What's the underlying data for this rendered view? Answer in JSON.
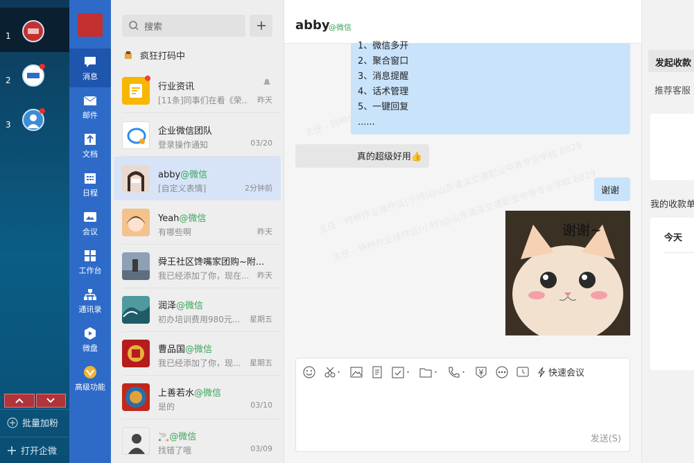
{
  "accounts": [
    {
      "num": "1"
    },
    {
      "num": "2",
      "badge": true
    },
    {
      "num": "3",
      "badge": true
    }
  ],
  "account_bar": {
    "batch_add": "批量加粉",
    "open_wecom": "打开企微"
  },
  "nav": [
    {
      "label": "消息",
      "icon": "chat-bubble-icon"
    },
    {
      "label": "邮件",
      "icon": "mail-icon"
    },
    {
      "label": "文档",
      "icon": "document-icon"
    },
    {
      "label": "日程",
      "icon": "calendar-icon"
    },
    {
      "label": "会议",
      "icon": "meeting-icon"
    },
    {
      "label": "工作台",
      "icon": "workbench-icon"
    },
    {
      "label": "通讯录",
      "icon": "contacts-icon"
    },
    {
      "label": "微盘",
      "icon": "cloud-drive-icon"
    },
    {
      "label": "高级功能",
      "icon": "advanced-icon"
    }
  ],
  "search": {
    "placeholder": "搜索"
  },
  "status": {
    "text": "疯狂打码中"
  },
  "conversations": [
    {
      "name": "行业资讯",
      "wx": "",
      "preview": "[11条]同事们在看《荣...",
      "time": "昨天",
      "badge": true,
      "muted": true,
      "color": "#f7b600"
    },
    {
      "name": "企业微信团队",
      "wx": "",
      "preview": "登录操作通知",
      "time": "03/20",
      "color": "#ffffff"
    },
    {
      "name": "abby",
      "wx": "@微信",
      "preview": "[自定义表情]",
      "time": "2分钟前",
      "color": "#e9d9d1"
    },
    {
      "name": "Yeah",
      "wx": "@微信",
      "preview": "有哪些啊",
      "time": "昨天",
      "color": "#f3c38d"
    },
    {
      "name": "舜王社区馋嘴家团购~附...",
      "wx": "",
      "preview": "我已经添加了你，现在...",
      "time": "昨天",
      "color": "#8da0b6"
    },
    {
      "name": "润泽",
      "wx": "@微信",
      "preview": "初办培训费用980元...",
      "time": "星期五",
      "color": "#4f9a9e"
    },
    {
      "name": "曹品国",
      "wx": "@微信",
      "preview": "我已经添加了你，现...",
      "time": "星期五",
      "color": "#b61c1c"
    },
    {
      "name": "上善若水",
      "wx": "@微信",
      "preview": "是的",
      "time": "03/10",
      "color": "#c1281c"
    },
    {
      "name": "🚬",
      "wx": "@微信",
      "preview": "找错了哦",
      "time": "03/09",
      "color": "#eeeeee"
    }
  ],
  "chat": {
    "title": "abby",
    "subtitle": "@微信",
    "list_items": [
      "1、微信多开",
      "2、聚合窗口",
      "3、消息提醒",
      "4、话术管理",
      "5、一键回复",
      "......"
    ],
    "msg_received": "真的超级好用👍",
    "msg_sent": "谢谢",
    "sticker_text": "谢谢~",
    "quick_meeting": "快速会议",
    "send_label": "发送(S)"
  },
  "right_panel": {
    "collect": "发起收款",
    "recommend": "推荐客服",
    "my_orders": "我的收款单",
    "today": "今天"
  },
  "watermarks": [
    "主任 - 特种作业操作证(小特)@山东清泽交通职业中等专业学校 8829"
  ],
  "colors": {
    "accent": "#2e6bc9",
    "bubble": "#c9e3fb",
    "wechat_green": "#3aa65a"
  }
}
